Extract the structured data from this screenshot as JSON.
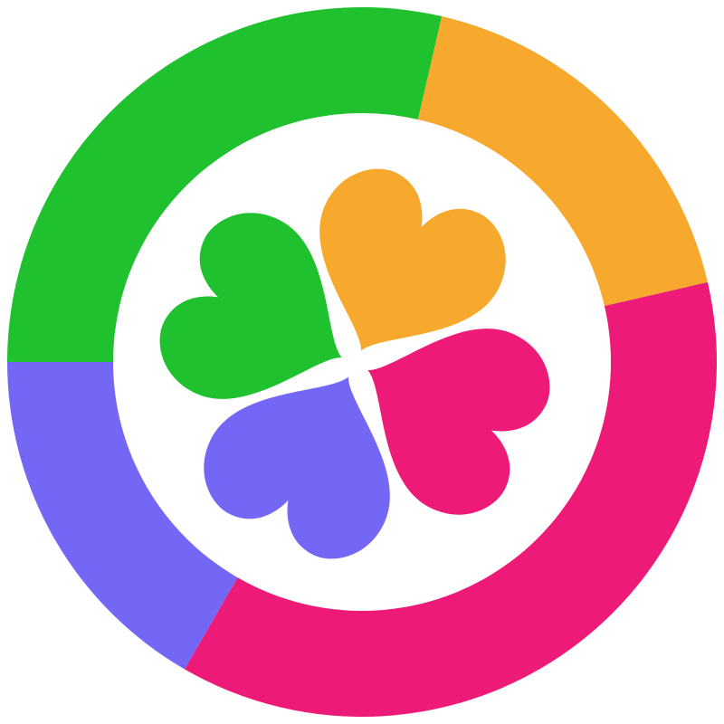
{
  "logo": {
    "name": "four-heart-clover-logo",
    "colors": {
      "green": "#1FC12E",
      "orange": "#F7A92E",
      "pink": "#ED1A77",
      "purple": "#7467F6",
      "background": "#FFFFFF"
    },
    "ring_segments": [
      "green",
      "orange",
      "pink",
      "purple"
    ],
    "clover_petals": [
      "green",
      "orange",
      "pink",
      "purple"
    ]
  }
}
